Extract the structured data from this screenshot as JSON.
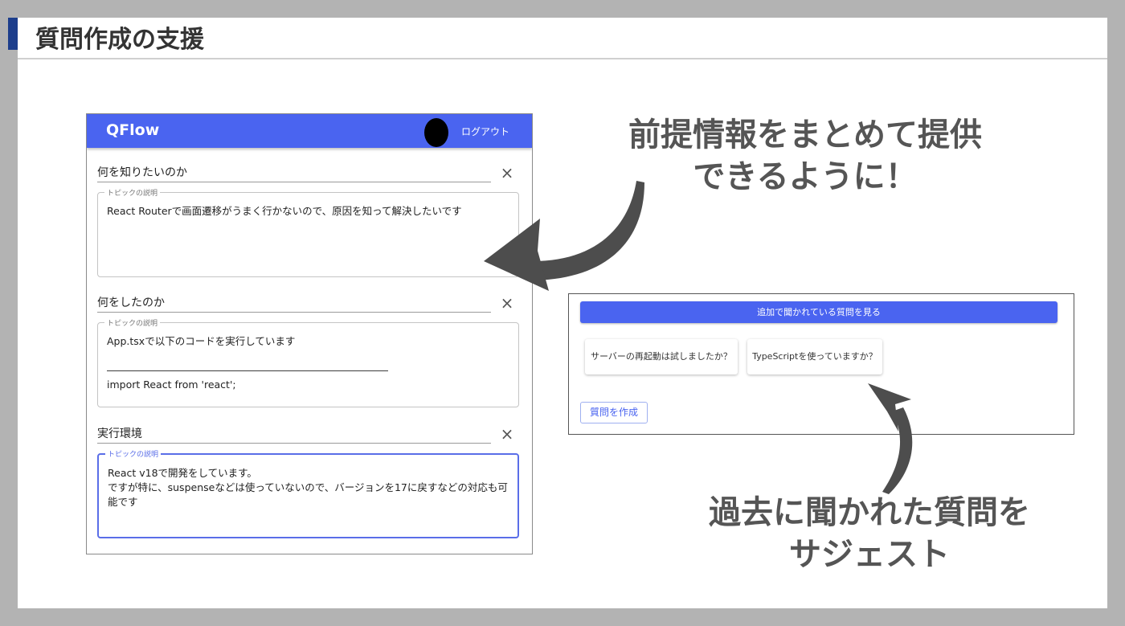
{
  "slide": {
    "title": "質問作成の支援",
    "headline_1": [
      "前提情報をまとめて提供",
      "できるように！"
    ],
    "headline_2": [
      "過去に聞かれた質問を",
      "サジェスト"
    ]
  },
  "app": {
    "brand": "QFlow",
    "logout_label": "ログアウト",
    "close_glyph": "×",
    "legend_label": "トピックの説明",
    "topics": [
      {
        "title": "何を知りたいのか",
        "description": "React Routerで画面遷移がうまく行かないので、原因を知って解決したいです"
      },
      {
        "title": "何をしたのか",
        "description": "App.tsxで以下のコードを実行しています\n\n――――――――――――――――――――――――――――\nimport React from 'react';"
      },
      {
        "title": "実行環境",
        "description": "React v18で開発をしています。\nですが特に、suspenseなどは使っていないので、バージョンを17に戻すなどの対応も可能です"
      }
    ]
  },
  "suggest": {
    "more_button_label": "追加で聞かれている質問を見る",
    "suggestions": [
      "サーバーの再起動は試しましたか？",
      "TypeScriptを使っていますか？"
    ],
    "create_button_label": "質問を作成"
  },
  "colors": {
    "primary": "#4a64f0",
    "title_accent": "#1d3e8c",
    "headline_text": "#555555",
    "arrow": "#4d4d4d"
  }
}
